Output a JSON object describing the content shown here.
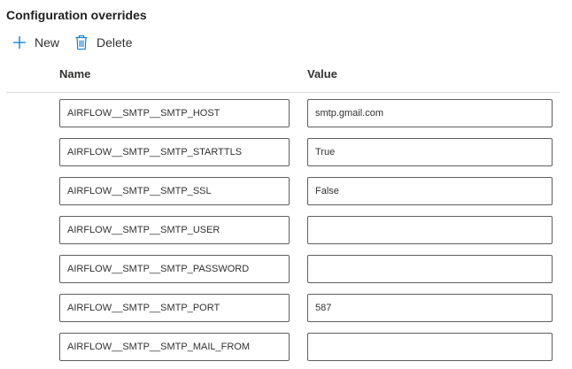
{
  "panel": {
    "title": "Configuration overrides"
  },
  "toolbar": {
    "new_label": "New",
    "new_icon": "plus-icon",
    "delete_label": "Delete",
    "delete_icon": "trash-icon",
    "icon_color": "#0078d4"
  },
  "table": {
    "columns": [
      "Name",
      "Value"
    ],
    "rows": [
      {
        "name": "AIRFLOW__SMTP__SMTP_HOST",
        "value": "smtp.gmail.com"
      },
      {
        "name": "AIRFLOW__SMTP__SMTP_STARTTLS",
        "value": "True"
      },
      {
        "name": "AIRFLOW__SMTP__SMTP_SSL",
        "value": "False"
      },
      {
        "name": "AIRFLOW__SMTP__SMTP_USER",
        "value": ""
      },
      {
        "name": "AIRFLOW__SMTP__SMTP_PASSWORD",
        "value": ""
      },
      {
        "name": "AIRFLOW__SMTP__SMTP_PORT",
        "value": "587"
      },
      {
        "name": "AIRFLOW__SMTP__SMTP_MAIL_FROM",
        "value": ""
      }
    ]
  }
}
